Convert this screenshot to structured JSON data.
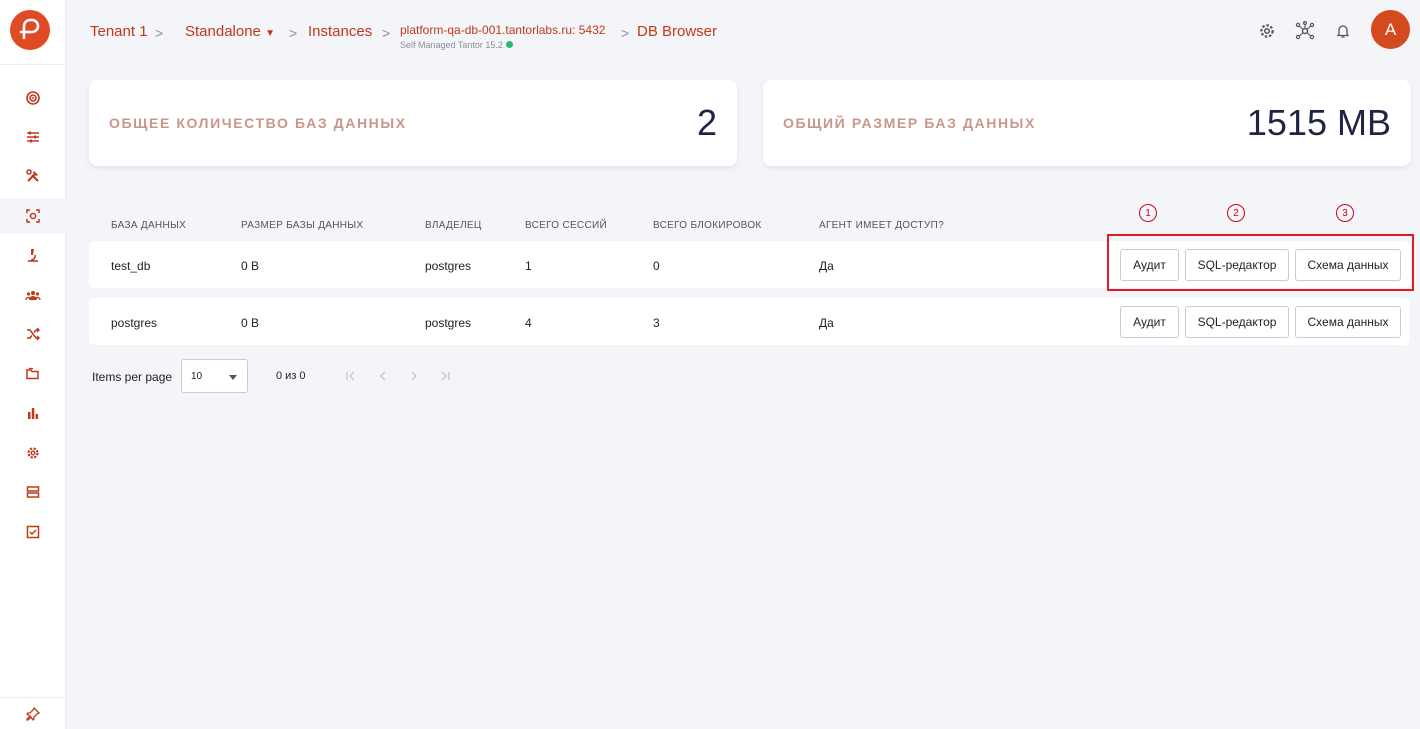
{
  "breadcrumb": {
    "tenant": "Tenant 1",
    "standalone": "Standalone",
    "instances": "Instances",
    "instance": "platform-qa-db-001.tantorlabs.ru: 5432",
    "instance_sub": "Self Managed Tantor 15.2",
    "page": "DB Browser",
    "separator": ">"
  },
  "user": {
    "avatar_letter": "A"
  },
  "stats": {
    "db_count_label": "Общее количество баз данных",
    "db_count_value": "2",
    "db_size_label": "Общий размер баз данных",
    "db_size_value": "1515 MB"
  },
  "table": {
    "headers": [
      "БАЗА ДАННЫХ",
      "РАЗМЕР БАЗЫ ДАННЫХ",
      "ВЛАДЕЛЕЦ",
      "ВСЕГО СЕССИЙ",
      "ВСЕГО БЛОКИРОВОК",
      "АГЕНТ ИМЕЕТ ДОСТУП?"
    ],
    "rows": [
      {
        "name": "test_db",
        "size": "0 B",
        "owner": "postgres",
        "sessions": "1",
        "locks": "0",
        "agent_access": "Да"
      },
      {
        "name": "postgres",
        "size": "0 B",
        "owner": "postgres",
        "sessions": "4",
        "locks": "3",
        "agent_access": "Да"
      }
    ],
    "actions": {
      "audit": "Аудит",
      "sql_editor": "SQL-редактор",
      "schema": "Схема данных"
    }
  },
  "markers": [
    "1",
    "2",
    "3"
  ],
  "pagination": {
    "items_per_page_label": "Items per page",
    "items_per_page_value": "10",
    "range": "0 из 0"
  },
  "colors": {
    "accent": "#c0391b",
    "logo": "#e04a24",
    "highlight": "#e01b24"
  }
}
